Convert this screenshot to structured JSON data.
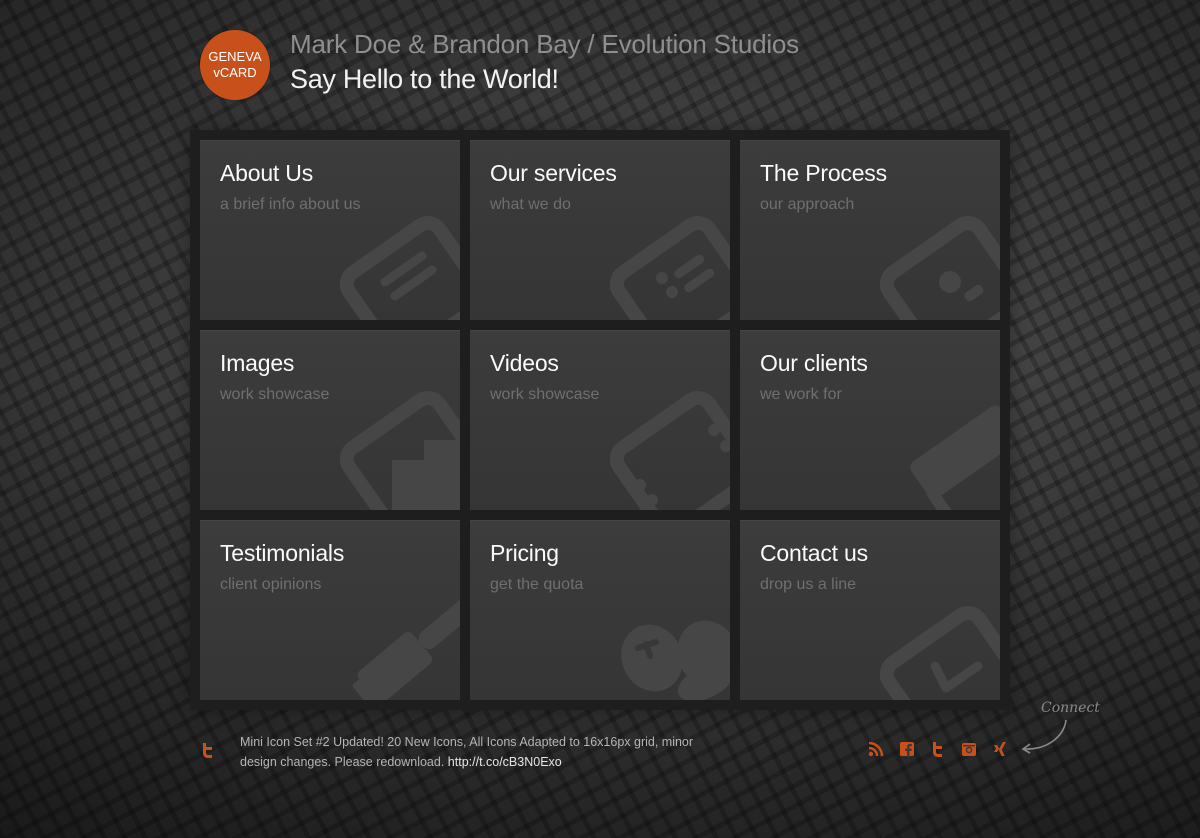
{
  "logo": {
    "line1": "GENEVA",
    "line2": "vCARD"
  },
  "header": {
    "subtitle": "Mark Doe & Brandon Bay / Evolution Studios",
    "title": "Say Hello to the World!"
  },
  "tiles": [
    {
      "title": "About Us",
      "subtitle": "a brief info about us",
      "icon": "document-icon"
    },
    {
      "title": "Our services",
      "subtitle": "what we do",
      "icon": "list-card-icon"
    },
    {
      "title": "The Process",
      "subtitle": "our approach",
      "icon": "profile-card-icon"
    },
    {
      "title": "Images",
      "subtitle": "work showcase",
      "icon": "image-icon"
    },
    {
      "title": "Videos",
      "subtitle": "work showcase",
      "icon": "film-icon"
    },
    {
      "title": "Our clients",
      "subtitle": "we work for",
      "icon": "client-card-icon"
    },
    {
      "title": "Testimonials",
      "subtitle": "client opinions",
      "icon": "brush-icon"
    },
    {
      "title": "Pricing",
      "subtitle": "get the quota",
      "icon": "coins-icon"
    },
    {
      "title": "Contact us",
      "subtitle": "drop us a line",
      "icon": "mail-icon"
    }
  ],
  "footer": {
    "tweet_text": "Mini Icon Set #2 Updated! 20 New Icons, All Icons Adapted to 16x16px grid, minor design changes. Please redownload. ",
    "tweet_link": "http://t.co/cB3N0Exo",
    "connect_label": "Connect",
    "social": [
      "rss-icon",
      "facebook-icon",
      "twitter-icon",
      "instagram-icon",
      "xing-icon"
    ]
  },
  "colors": {
    "accent": "#c8511b",
    "tile_bg": "#3a3a3a",
    "frame_bg": "#1e1e1e"
  }
}
